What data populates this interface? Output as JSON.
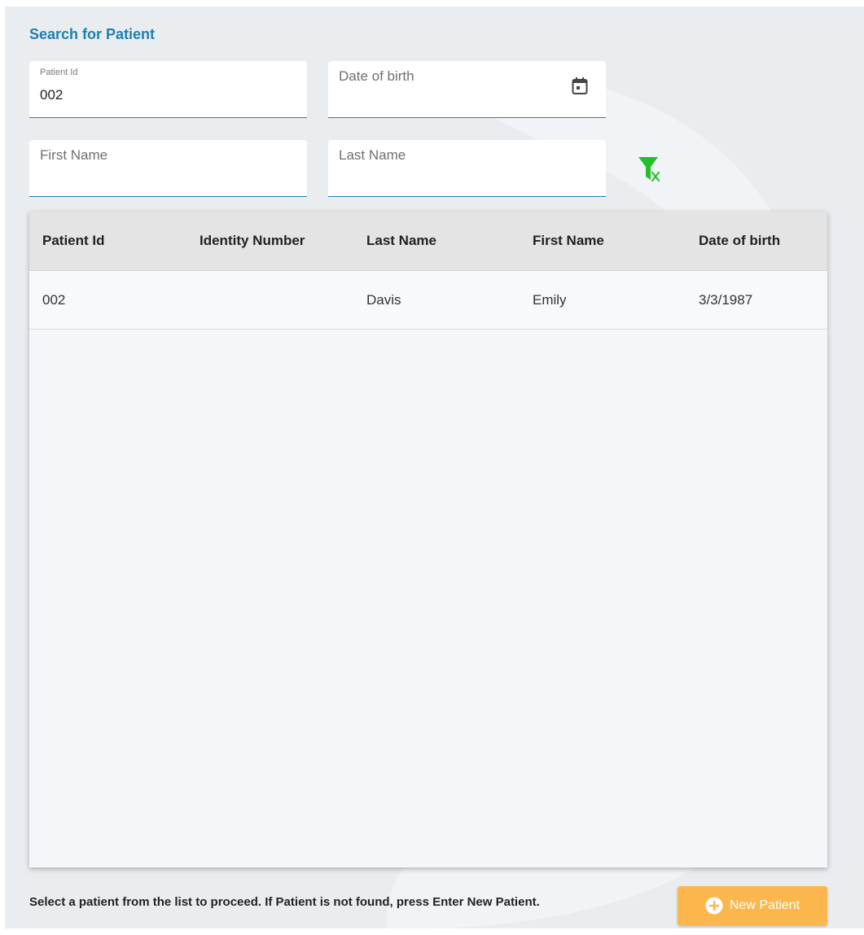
{
  "search": {
    "title": "Search for Patient",
    "patient_id": {
      "label": "Patient Id",
      "value": "002"
    },
    "date_of_birth": {
      "label": "Date of birth",
      "value": ""
    },
    "first_name": {
      "label": "First Name",
      "value": ""
    },
    "last_name": {
      "label": "Last Name",
      "value": ""
    },
    "clear_filter_icon": "filter-clear-icon",
    "calendar_icon": "calendar-icon"
  },
  "grid": {
    "columns": [
      "Patient Id",
      "Identity Number",
      "Last Name",
      "First Name",
      "Date of birth"
    ],
    "rows": [
      {
        "patient_id": "002",
        "identity_number": "",
        "last_name": "Davis",
        "first_name": "Emily",
        "date_of_birth": "3/3/1987"
      }
    ]
  },
  "footer": {
    "hint": "Select a patient from the list to proceed. If Patient is not found, press Enter New Patient.",
    "new_patient_label": "New Patient",
    "new_patient_icon": "plus-circle-icon"
  },
  "colors": {
    "accent": "#1f7fae",
    "button": "#fbb74e",
    "filter_icon": "#22c02a",
    "background": "#e9edf0"
  }
}
